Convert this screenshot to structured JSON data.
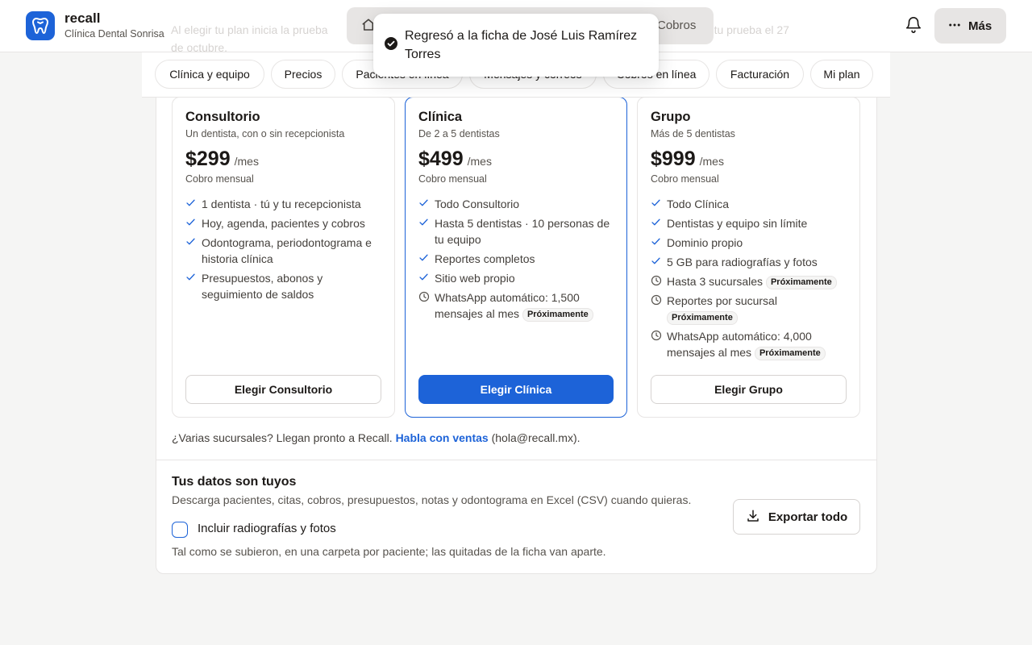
{
  "header": {
    "brand_name": "recall",
    "brand_sub": "Clínica Dental Sonrisa",
    "ghost_left": "Al elegir tu plan inicia la prueba",
    "ghost_left_2": "de octubre.",
    "ghost_right": "ta tu prueba el 27",
    "nav_cobros": "Cobros",
    "more_label": "Más"
  },
  "toast": {
    "message": "Regresó a la ficha de José Luis Ramírez Torres"
  },
  "tabs": [
    {
      "label": "Clínica y equipo"
    },
    {
      "label": "Precios"
    },
    {
      "label": "Pacientes en línea"
    },
    {
      "label": "Mensajes y correos"
    },
    {
      "label": "Cobros en línea"
    },
    {
      "label": "Facturación"
    },
    {
      "label": "Mi plan"
    }
  ],
  "plans": [
    {
      "name": "Consultorio",
      "desc": "Un dentista, con o sin recepcionista",
      "price": "$299",
      "per": "/mes",
      "billing": "Cobro mensual",
      "features": [
        {
          "text": "1 dentista · tú y tu recepcionista"
        },
        {
          "text": "Hoy, agenda, pacientes y cobros"
        },
        {
          "text": "Odontograma, periodontograma e historia clínica"
        },
        {
          "text": "Presupuestos, abonos y seguimiento de saldos"
        }
      ],
      "cta": "Elegir Consultorio"
    },
    {
      "name": "Clínica",
      "desc": "De 2 a 5 dentistas",
      "price": "$499",
      "per": "/mes",
      "billing": "Cobro mensual",
      "features": [
        {
          "text": "Todo Consultorio"
        },
        {
          "text": "Hasta 5 dentistas · 10 personas de tu equipo"
        },
        {
          "text": "Reportes completos"
        },
        {
          "text": "Sitio web propio"
        },
        {
          "text": "WhatsApp automático: 1,500 mensajes al mes",
          "badge": "Próximamente"
        }
      ],
      "cta": "Elegir Clínica"
    },
    {
      "name": "Grupo",
      "desc": "Más de 5 dentistas",
      "price": "$999",
      "per": "/mes",
      "billing": "Cobro mensual",
      "features": [
        {
          "text": "Todo Clínica"
        },
        {
          "text": "Dentistas y equipo sin límite"
        },
        {
          "text": "Dominio propio"
        },
        {
          "text": "5 GB para radiografías y fotos"
        },
        {
          "text": "Hasta 3 sucursales",
          "badge": "Próximamente"
        },
        {
          "text": "Reportes por sucursal",
          "badge": "Próximamente"
        },
        {
          "text": "WhatsApp automático: 4,000 mensajes al mes",
          "badge": "Próximamente"
        }
      ],
      "cta": "Elegir Grupo"
    }
  ],
  "branches": {
    "prefix": "¿Varias sucursales? Llegan pronto a Recall.",
    "link": "Habla con ventas",
    "suffix": "(hola@recall.mx)."
  },
  "data_section": {
    "title": "Tus datos son tuyos",
    "desc": "Descarga pacientes, citas, cobros, presupuestos, notas y odontograma en Excel (CSV) cuando quieras.",
    "checkbox_label": "Incluir radiografías y fotos",
    "note": "Tal como se subieron, en una carpeta por paciente; las quitadas de la ficha van aparte.",
    "export_label": "Exportar todo"
  },
  "colors": {
    "accent": "#1d63d8",
    "border": "#e7e5e4",
    "background": "#f5f5f4"
  }
}
